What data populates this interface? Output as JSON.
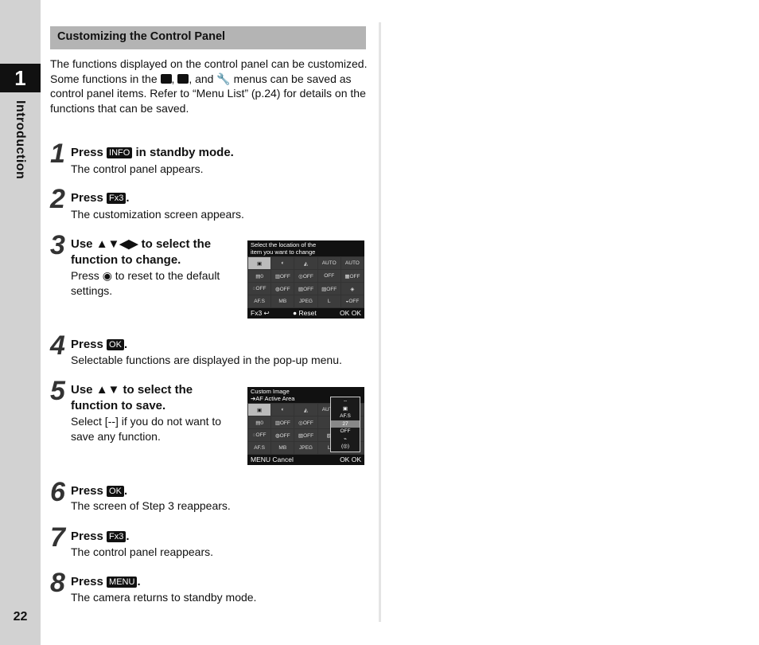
{
  "sidebar": {
    "chapter_number": "1",
    "chapter_title": "Introduction",
    "page_number": "22"
  },
  "section": {
    "title": "Customizing the Control Panel",
    "intro_1": "The functions displayed on the control panel can be customized.",
    "intro_2a": "Some functions in the ",
    "intro_2b": ", ",
    "intro_2c": ", and ",
    "intro_2d": " menus can be saved as control panel items. Refer to “Menu List” (p.24) for details on the functions that can be saved.",
    "menu_icons": [
      "camera-icon",
      "movie-icon",
      "wrench-icon"
    ]
  },
  "steps": [
    {
      "num": "1",
      "pre": "Press ",
      "key": "INFO",
      "post": " in standby mode.",
      "body": "The control panel appears."
    },
    {
      "num": "2",
      "pre": "Press ",
      "key": "Fx3",
      "post": ".",
      "body": "The customization screen appears."
    },
    {
      "num": "3",
      "pre": "Use ",
      "key": "▲▼◀▶",
      "post": " to select the",
      "post2": "function to change.",
      "body1": "Press ",
      "body_key": "◉",
      "body2": " to reset to the default",
      "body3": "settings."
    },
    {
      "num": "4",
      "pre": "Press ",
      "key": "OK",
      "post": ".",
      "body": "Selectable functions are displayed in the pop-up menu."
    },
    {
      "num": "5",
      "pre": "Use ",
      "key": "▲▼",
      "post": " to select the",
      "post2": "function to save.",
      "body1": "Select [--] if you do not want to",
      "body3": "save any function."
    },
    {
      "num": "6",
      "pre": "Press ",
      "key": "OK",
      "post": ".",
      "body": "The screen of Step 3 reappears."
    },
    {
      "num": "7",
      "pre": "Press ",
      "key": "Fx3",
      "post": ".",
      "body": "The control panel reappears."
    },
    {
      "num": "8",
      "pre": "Press ",
      "key": "MENU",
      "post": ".",
      "body": "The camera returns to standby mode."
    }
  ],
  "screen1": {
    "title1": "Select the location of the",
    "title2": "item you want to change",
    "cells": [
      "▣",
      "◐",
      "◭",
      "AUTO",
      "AUTO",
      "▤0",
      "▥OFF",
      "◎OFF",
      "OFF",
      "▦OFF",
      "◌OFF",
      "◍OFF",
      "▧OFF",
      "▨OFF",
      "◈",
      "AF.S",
      "MB",
      "JPEG",
      "L",
      "◒OFF"
    ],
    "foot_left": "Fx3 ↩",
    "foot_mid": "● Reset",
    "foot_right": "OK OK"
  },
  "screen2": {
    "title1": "Custom Image",
    "title2": "➔AF Active Area",
    "cells": [
      "▣",
      "◐",
      "◭",
      "AUTO",
      "",
      "▤0",
      "▥OFF",
      "◎OFF",
      "",
      "",
      "◌OFF",
      "◍OFF",
      "▧OFF",
      "▨",
      "",
      "AF.S",
      "MB",
      "JPEG",
      "L",
      ""
    ],
    "popup": [
      "--",
      "▣",
      "AF.S",
      "27",
      "OFF",
      "⌁",
      "(◎)"
    ],
    "foot_left": "MENU Cancel",
    "foot_right": "OK OK"
  }
}
